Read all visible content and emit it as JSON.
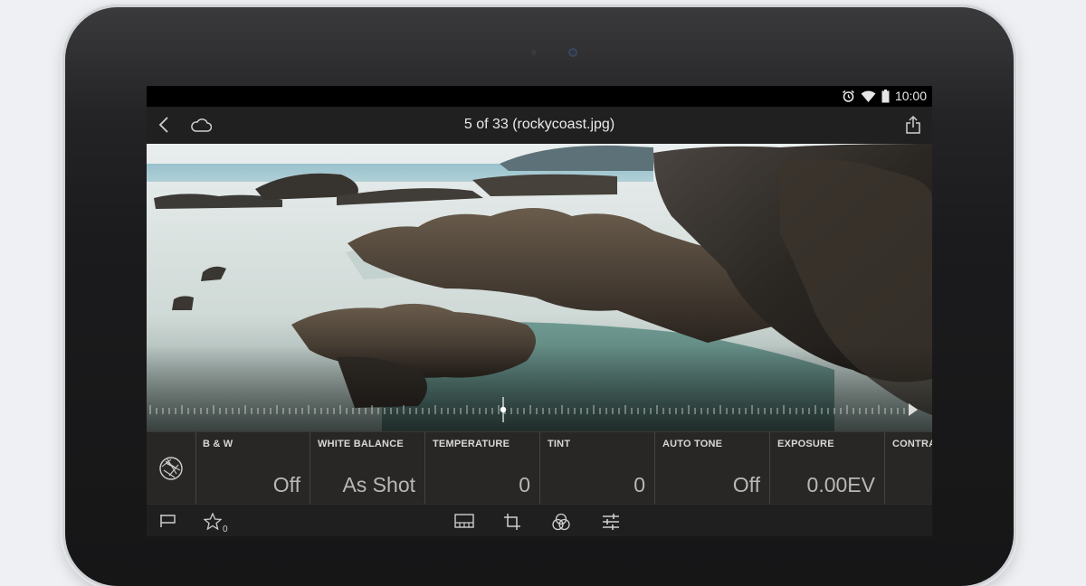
{
  "status_bar": {
    "time": "10:00"
  },
  "header": {
    "title": "5 of 33 (rockycoast.jpg)"
  },
  "adjustments": [
    {
      "label": "B & W",
      "value": "Off"
    },
    {
      "label": "WHITE BALANCE",
      "value": "As Shot"
    },
    {
      "label": "TEMPERATURE",
      "value": "0"
    },
    {
      "label": "TINT",
      "value": "0"
    },
    {
      "label": "AUTO TONE",
      "value": "Off"
    },
    {
      "label": "EXPOSURE",
      "value": "0.00EV"
    },
    {
      "label": "CONTRAS",
      "value": ""
    }
  ],
  "bottom_bar": {
    "star_count": "0"
  },
  "colors": {
    "bezel": "#1b1b1d",
    "panel": "#2a2826",
    "status_bar": "#000000",
    "title_bar": "#202020"
  },
  "icons": [
    "alarm-icon",
    "wifi-icon",
    "battery-icon",
    "back-arrow-icon",
    "cloud-icon",
    "share-icon",
    "camera-aperture-icon",
    "flag-icon",
    "star-icon",
    "filmstrip-icon",
    "crop-icon",
    "presets-icon",
    "sliders-icon"
  ]
}
